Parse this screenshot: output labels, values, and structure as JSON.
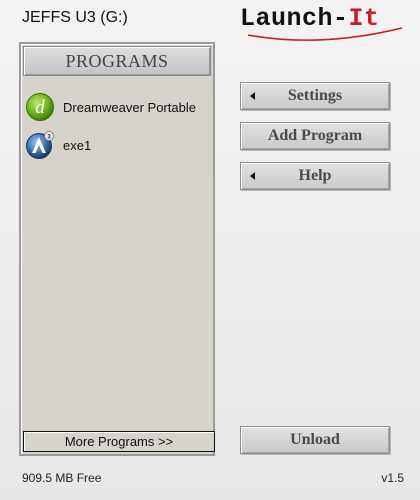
{
  "window": {
    "drive_label": "JEFFS U3 (G:)",
    "logo": {
      "text_main": "Launch-",
      "text_accent": "It",
      "accent_color": "#c81d25"
    }
  },
  "programs_panel": {
    "header": "PROGRAMS",
    "items": [
      {
        "label": "Dreamweaver Portable",
        "icon": "dreamweaver-icon"
      },
      {
        "label": "exe1",
        "icon": "generic-app-icon"
      }
    ],
    "more_button": "More Programs >>"
  },
  "actions": {
    "settings": "Settings",
    "add_program": "Add Program",
    "help": "Help",
    "unload": "Unload"
  },
  "footer": {
    "free_space": "909.5 MB Free",
    "version": "v1.5"
  },
  "colors": {
    "panel_bg": "#d6d3cd",
    "button_text": "#4a4a4a",
    "dreamweaver_green": "#6fb51f"
  }
}
